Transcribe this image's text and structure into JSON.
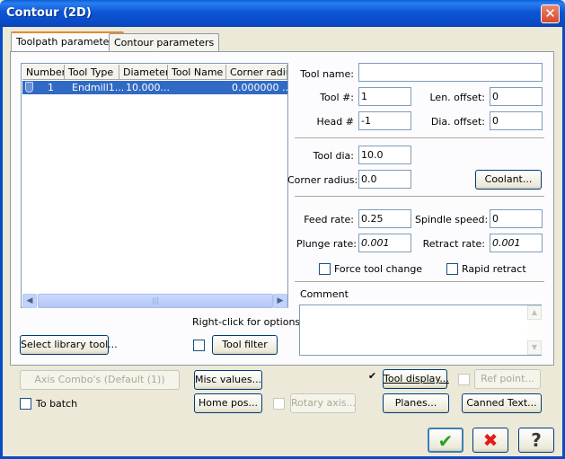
{
  "window": {
    "title": "Contour (2D)"
  },
  "tabs": [
    {
      "label": "Toolpath parameters"
    },
    {
      "label": "Contour parameters"
    }
  ],
  "tool_list": {
    "columns": [
      "Number",
      "Tool Type",
      "Diameter",
      "Tool Name",
      "Corner radius"
    ],
    "rows": [
      {
        "number": "1",
        "tool_type": "Endmill1...",
        "diameter": "10.000...",
        "tool_name": "",
        "corner_radius": "0.000000 ..."
      }
    ],
    "hint": "Right-click for options"
  },
  "buttons": {
    "select_library_tool": "Select library tool...",
    "tool_filter": "Tool filter",
    "coolant": "Coolant...",
    "axis_combo": "Axis Combo's (Default (1))",
    "misc_values": "Misc values...",
    "tool_display": "Tool display...",
    "ref_point": "Ref point...",
    "home_pos": "Home pos...",
    "rotary_axis": "Rotary axis...",
    "planes": "Planes...",
    "canned_text": "Canned Text..."
  },
  "fields": {
    "tool_name": {
      "label": "Tool name:",
      "value": ""
    },
    "tool_number": {
      "label": "Tool #:",
      "value": "1"
    },
    "len_offset": {
      "label": "Len. offset:",
      "value": "0"
    },
    "head_number": {
      "label": "Head #",
      "value": "-1"
    },
    "dia_offset": {
      "label": "Dia. offset:",
      "value": "0"
    },
    "tool_dia": {
      "label": "Tool dia:",
      "value": "10.0"
    },
    "corner_radius": {
      "label": "Corner radius:",
      "value": "0.0"
    },
    "feed_rate": {
      "label": "Feed rate:",
      "value": "0.25"
    },
    "spindle_speed": {
      "label": "Spindle speed:",
      "value": "0"
    },
    "plunge_rate": {
      "label": "Plunge rate:",
      "value": "0.001"
    },
    "retract_rate": {
      "label": "Retract rate:",
      "value": "0.001"
    }
  },
  "checkboxes": {
    "force_tool_change": {
      "label": "Force tool change",
      "checked": false
    },
    "rapid_retract": {
      "label": "Rapid retract",
      "checked": false
    },
    "to_batch": {
      "label": "To batch",
      "checked": false
    },
    "tool_filter": {
      "checked": false
    },
    "tool_display": {
      "checked": true,
      "mark": "✔"
    },
    "ref_point": {
      "checked": false
    },
    "rotary_axis": {
      "checked": false
    }
  },
  "comment": {
    "label": "Comment",
    "value": ""
  },
  "dialog_buttons": {
    "ok": "✔",
    "cancel": "✖",
    "help": "?"
  }
}
